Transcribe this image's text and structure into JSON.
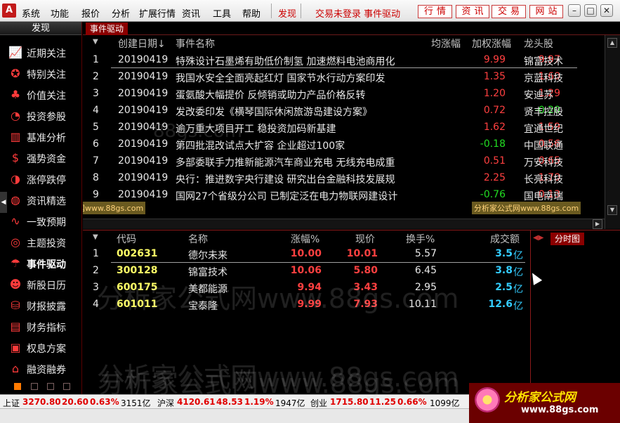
{
  "menubar": {
    "logo": "A",
    "items": [
      "系统",
      "功能",
      "报价",
      "分析",
      "扩展行情",
      "资讯",
      "工具",
      "帮助",
      "发现"
    ],
    "status": "交易未登录 事件驱动",
    "buttons": [
      "行情",
      "资讯",
      "交易",
      "网站"
    ],
    "window_controls": [
      "–",
      "□",
      "✕"
    ]
  },
  "sidebar": {
    "title": "发现",
    "items": [
      {
        "label": "近期关注",
        "icon": "trend-chart-icon"
      },
      {
        "label": "特别关注",
        "icon": "person-star-icon"
      },
      {
        "label": "价值关注",
        "icon": "piggy-bank-icon"
      },
      {
        "label": "投资参股",
        "icon": "pie-chart-icon"
      },
      {
        "label": "基准分析",
        "icon": "bar-chart-icon"
      },
      {
        "label": "强势资金",
        "icon": "money-bag-icon"
      },
      {
        "label": "涨停跌停",
        "icon": "gauge-icon"
      },
      {
        "label": "资讯精选",
        "icon": "globe-icon"
      },
      {
        "label": "一致预期",
        "icon": "line-chart-icon"
      },
      {
        "label": "主题投资",
        "icon": "target-icon"
      },
      {
        "label": "事件驱动",
        "icon": "umbrella-icon"
      },
      {
        "label": "新股日历",
        "icon": "globe-person-icon"
      },
      {
        "label": "财报披露",
        "icon": "coins-icon"
      },
      {
        "label": "财务指标",
        "icon": "document-icon"
      },
      {
        "label": "权息方案",
        "icon": "picture-icon"
      },
      {
        "label": "融资融券",
        "icon": "bank-icon"
      }
    ],
    "active": "事件驱动"
  },
  "tab": {
    "label": "事件驱动"
  },
  "events": {
    "columns": [
      "创建日期↓",
      "事件名称",
      "均涨幅",
      "加权涨幅",
      "龙头股"
    ],
    "rows": [
      {
        "n": "1",
        "date": "20190419",
        "name": "特殊设计石墨烯有助低价制氢 加速燃料电池商用化",
        "avg": "9.99",
        "wavg": "9.97",
        "leader": "锦富技术",
        "avg_dir": "up",
        "wavg_dir": "up"
      },
      {
        "n": "2",
        "date": "20190419",
        "name": "我国水安全全面亮起红灯 国家节水行动方案印发",
        "avg": "1.35",
        "wavg": "1.60",
        "leader": "京蓝科技",
        "avg_dir": "up",
        "wavg_dir": "up"
      },
      {
        "n": "3",
        "date": "20190419",
        "name": "蛋氨酸大幅提价 反倾销或助力产品价格反转",
        "avg": "1.20",
        "wavg": "1.29",
        "leader": "安迪苏",
        "avg_dir": "up",
        "wavg_dir": "up"
      },
      {
        "n": "4",
        "date": "20190419",
        "name": "发改委印发《横琴国际休闲旅游岛建设方案》",
        "avg": "0.72",
        "wavg": "-0.20",
        "leader": "贤丰控股",
        "avg_dir": "up",
        "wavg_dir": "down"
      },
      {
        "n": "5",
        "date": "20190419",
        "name": "逾万重大项目开工 稳投资加码新基建",
        "avg": "1.62",
        "wavg": "1.59",
        "leader": "宜通世纪",
        "avg_dir": "up",
        "wavg_dir": "up"
      },
      {
        "n": "6",
        "date": "20190419",
        "name": "第四批混改试点大扩容 企业超过100家",
        "avg": "-0.18",
        "wavg": "0.56",
        "leader": "中国联通",
        "avg_dir": "down",
        "wavg_dir": "up"
      },
      {
        "n": "7",
        "date": "20190419",
        "name": "多部委联手力推新能源汽车商业充电 无线充电成重",
        "avg": "0.51",
        "wavg": "0.65",
        "leader": "万安科技",
        "avg_dir": "up",
        "wavg_dir": "up"
      },
      {
        "n": "8",
        "date": "20190419",
        "name": "央行：推进数字央行建设 研究出台金融科技发展规",
        "avg": "2.25",
        "wavg": "1.70",
        "leader": "长亮科技",
        "avg_dir": "up",
        "wavg_dir": "up"
      },
      {
        "n": "9",
        "date": "20190419",
        "name": "国网27个省级分公司 已制定泛在电力物联网建设计",
        "avg": "-0.76",
        "wavg": "0.13",
        "leader": "国电南瑞",
        "avg_dir": "down",
        "wavg_dir": "up"
      }
    ]
  },
  "stocks": {
    "columns": [
      "代码",
      "名称",
      "涨幅%",
      "现价",
      "换手%",
      "成交额"
    ],
    "rows": [
      {
        "n": "1",
        "code": "002631",
        "name": "德尔未来",
        "chg": "10.00",
        "price": "10.01",
        "turnover": "5.57",
        "amount": "3.5",
        "unit": "亿"
      },
      {
        "n": "2",
        "code": "300128",
        "name": "锦富技术",
        "chg": "10.06",
        "price": "5.80",
        "turnover": "6.45",
        "amount": "3.8",
        "unit": "亿"
      },
      {
        "n": "3",
        "code": "600175",
        "name": "美都能源",
        "chg": "9.94",
        "price": "3.43",
        "turnover": "2.95",
        "amount": "2.5",
        "unit": "亿"
      },
      {
        "n": "4",
        "code": "601011",
        "name": "宝泰隆",
        "chg": "9.99",
        "price": "7.93",
        "turnover": "10.11",
        "amount": "12.6",
        "unit": "亿"
      }
    ]
  },
  "minute_panel": {
    "tab": "分时图",
    "arrows": "◀▶"
  },
  "watermarks": {
    "tag": "分析家公式网www.88gs.com",
    "big": "分析家公式网www.88gs.com",
    "mid": "88gs.com"
  },
  "statusbar": {
    "sh": {
      "name": "上证",
      "value": "3270.80",
      "chg": "20.60",
      "pct": "0.63%",
      "vol": "3151亿"
    },
    "sz": {
      "name": "沪深",
      "value": "4120.61",
      "chg": "48.53",
      "pct": "1.19%",
      "vol": "1947亿"
    },
    "cy": {
      "name": "创业",
      "value": "1715.80",
      "chg": "11.25",
      "pct": "0.66%",
      "vol": "1099亿"
    }
  },
  "brand": {
    "name": "分析家公式网",
    "url": "www.88gs.com"
  },
  "colors": {
    "up": "#ff4040",
    "down": "#22dd22",
    "code": "#ffff66",
    "amount": "#33ccff",
    "tab": "#8b0000"
  }
}
